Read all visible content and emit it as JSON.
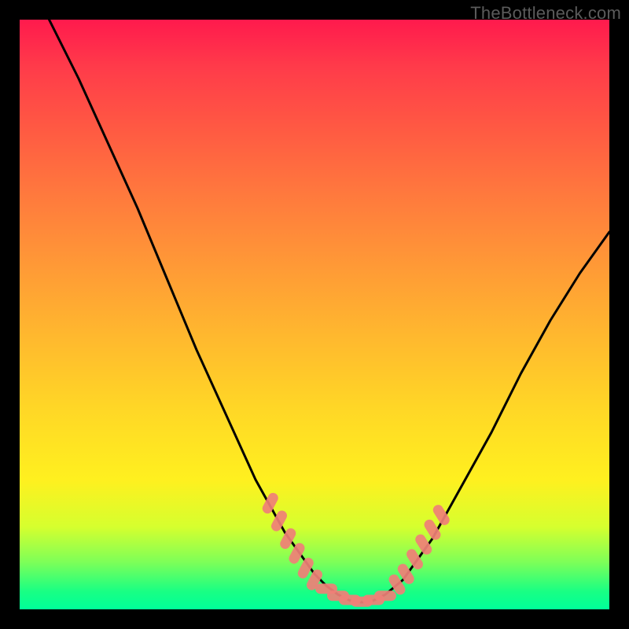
{
  "watermark": "TheBottleneck.com",
  "colors": {
    "page_bg": "#000000",
    "curve": "#000000",
    "marker_fill": "#f08078",
    "marker_stroke": "#f08078"
  },
  "chart_data": {
    "type": "line",
    "title": "",
    "xlabel": "",
    "ylabel": "",
    "xlim": [
      0,
      100
    ],
    "ylim": [
      0,
      100
    ],
    "grid": false,
    "legend": false,
    "series": [
      {
        "name": "bottleneck-curve",
        "x": [
          5,
          10,
          15,
          20,
          25,
          30,
          35,
          40,
          45,
          50,
          52,
          54,
          56,
          58,
          60,
          62,
          65,
          70,
          75,
          80,
          85,
          90,
          95,
          100
        ],
        "y": [
          100,
          90,
          79,
          68,
          56,
          44,
          33,
          22,
          13,
          6,
          4,
          2.5,
          1.5,
          1.2,
          1.5,
          2.5,
          5,
          12,
          21,
          30,
          40,
          49,
          57,
          64
        ]
      }
    ],
    "markers": [
      {
        "series": "left-cluster",
        "x": 42.5,
        "y": 18.0
      },
      {
        "series": "left-cluster",
        "x": 44.0,
        "y": 15.0
      },
      {
        "series": "left-cluster",
        "x": 45.5,
        "y": 12.0
      },
      {
        "series": "left-cluster",
        "x": 47.0,
        "y": 9.5
      },
      {
        "series": "left-cluster",
        "x": 48.5,
        "y": 7.0
      },
      {
        "series": "left-cluster",
        "x": 50.0,
        "y": 5.0
      },
      {
        "series": "bottom",
        "x": 52.0,
        "y": 3.5
      },
      {
        "series": "bottom",
        "x": 54.0,
        "y": 2.3
      },
      {
        "series": "bottom",
        "x": 56.0,
        "y": 1.6
      },
      {
        "series": "bottom",
        "x": 58.0,
        "y": 1.3
      },
      {
        "series": "bottom",
        "x": 60.0,
        "y": 1.6
      },
      {
        "series": "bottom",
        "x": 62.0,
        "y": 2.3
      },
      {
        "series": "right-cluster",
        "x": 64.0,
        "y": 4.2
      },
      {
        "series": "right-cluster",
        "x": 65.5,
        "y": 6.0
      },
      {
        "series": "right-cluster",
        "x": 67.0,
        "y": 8.5
      },
      {
        "series": "right-cluster",
        "x": 68.5,
        "y": 11.0
      },
      {
        "series": "right-cluster",
        "x": 70.0,
        "y": 13.5
      },
      {
        "series": "right-cluster",
        "x": 71.5,
        "y": 16.0
      }
    ]
  }
}
